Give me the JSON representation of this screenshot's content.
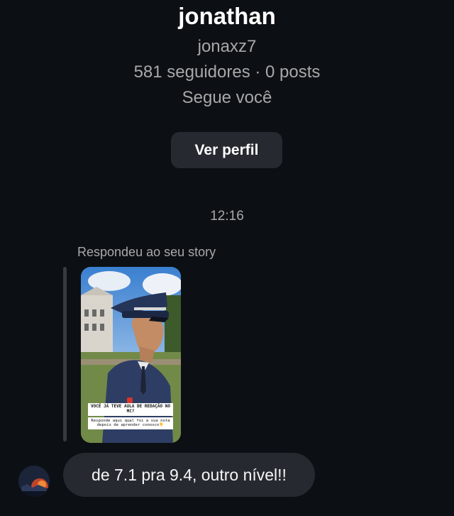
{
  "profile": {
    "name": "jonathan",
    "username": "jonaxz7",
    "stats": "581 seguidores · 0 posts",
    "follow_status": "Segue você",
    "view_profile_label": "Ver perfil"
  },
  "thread": {
    "timestamp": "12:16",
    "story_reply_caption": "Respondeu ao seu story",
    "story": {
      "question_text": "VOCÊ JÁ TEVE AULA DE REDAÇÃO NO MC?",
      "response_text": "Responde aqui qual foi a sua nota depois de aprender conosco👇"
    },
    "message": {
      "text": "de 7.1 pra 9.4, outro nível!!"
    }
  },
  "colors": {
    "background": "#0c1014",
    "bubble": "#262a30",
    "secondary_text": "#a8a8a8"
  }
}
